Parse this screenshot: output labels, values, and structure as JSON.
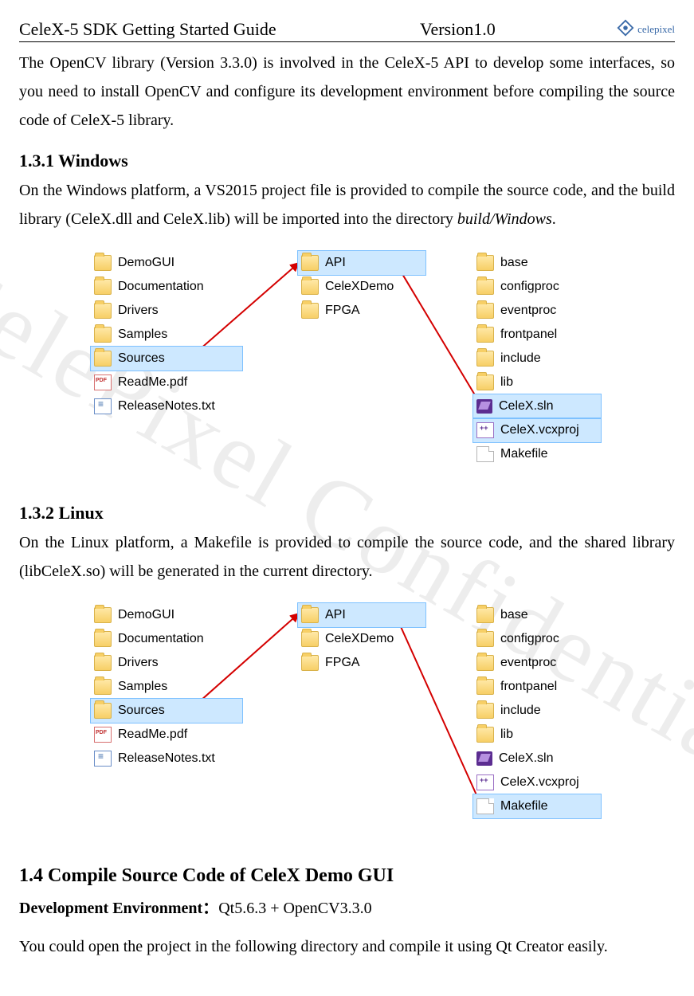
{
  "header": {
    "title": "CeleX-5 SDK Getting Started Guide",
    "version": "Version1.0",
    "logo_text": "celepixel"
  },
  "watermark": "CelePixel Confidential",
  "intro_paragraph": "The OpenCV library (Version 3.3.0) is involved in the CeleX-5 API to develop some interfaces, so you need to install OpenCV and configure its development environment before compiling the source code of CeleX-5 library.",
  "sec131": {
    "heading": "1.3.1    Windows",
    "p_part1": "On the Windows platform, a VS2015 project file is provided to compile the source code, and the build library (CeleX.dll and CeleX.lib) will be imported into the directory ",
    "p_italic": "build/Windows",
    "p_part2": "."
  },
  "sec132": {
    "heading": "1.3.2    Linux",
    "p": "On the Linux platform, a Makefile is provided to compile the source code, and the shared library (libCeleX.so) will be generated in the current directory."
  },
  "sec14": {
    "heading": "1.4   Compile Source Code of CeleX Demo GUI",
    "env_label": "Development Environment：",
    "env_value": "Qt5.6.3 + OpenCV3.3.0",
    "p": "You could open the project in the following directory and compile it using Qt Creator easily."
  },
  "fig1": {
    "colA": [
      {
        "icon": "folder",
        "name": "DemoGUI"
      },
      {
        "icon": "folder",
        "name": "Documentation"
      },
      {
        "icon": "folder",
        "name": "Drivers"
      },
      {
        "icon": "folder",
        "name": "Samples"
      },
      {
        "icon": "folder",
        "name": "Sources",
        "sel": true
      },
      {
        "icon": "pdf",
        "name": "ReadMe.pdf"
      },
      {
        "icon": "txt",
        "name": "ReleaseNotes.txt"
      }
    ],
    "colB": [
      {
        "icon": "folder",
        "name": "API",
        "sel": true
      },
      {
        "icon": "folder",
        "name": "CeleXDemo"
      },
      {
        "icon": "folder",
        "name": "FPGA"
      }
    ],
    "colC": [
      {
        "icon": "folder",
        "name": "base"
      },
      {
        "icon": "folder",
        "name": "configproc"
      },
      {
        "icon": "folder",
        "name": "eventproc"
      },
      {
        "icon": "folder",
        "name": "frontpanel"
      },
      {
        "icon": "folder",
        "name": "include"
      },
      {
        "icon": "folder",
        "name": "lib"
      },
      {
        "icon": "sln",
        "name": "CeleX.sln",
        "sel": true
      },
      {
        "icon": "vcx",
        "name": "CeleX.vcxproj",
        "sel": true
      },
      {
        "icon": "blank",
        "name": "Makefile"
      }
    ]
  },
  "fig2": {
    "colA": [
      {
        "icon": "folder",
        "name": "DemoGUI"
      },
      {
        "icon": "folder",
        "name": "Documentation"
      },
      {
        "icon": "folder",
        "name": "Drivers"
      },
      {
        "icon": "folder",
        "name": "Samples"
      },
      {
        "icon": "folder",
        "name": "Sources",
        "sel": true
      },
      {
        "icon": "pdf",
        "name": "ReadMe.pdf"
      },
      {
        "icon": "txt",
        "name": "ReleaseNotes.txt"
      }
    ],
    "colB": [
      {
        "icon": "folder",
        "name": "API",
        "sel": true
      },
      {
        "icon": "folder",
        "name": "CeleXDemo"
      },
      {
        "icon": "folder",
        "name": "FPGA"
      }
    ],
    "colC": [
      {
        "icon": "folder",
        "name": "base"
      },
      {
        "icon": "folder",
        "name": "configproc"
      },
      {
        "icon": "folder",
        "name": "eventproc"
      },
      {
        "icon": "folder",
        "name": "frontpanel"
      },
      {
        "icon": "folder",
        "name": "include"
      },
      {
        "icon": "folder",
        "name": "lib"
      },
      {
        "icon": "sln",
        "name": "CeleX.sln"
      },
      {
        "icon": "vcx",
        "name": "CeleX.vcxproj"
      },
      {
        "icon": "blank",
        "name": "Makefile",
        "sel": true
      }
    ]
  }
}
